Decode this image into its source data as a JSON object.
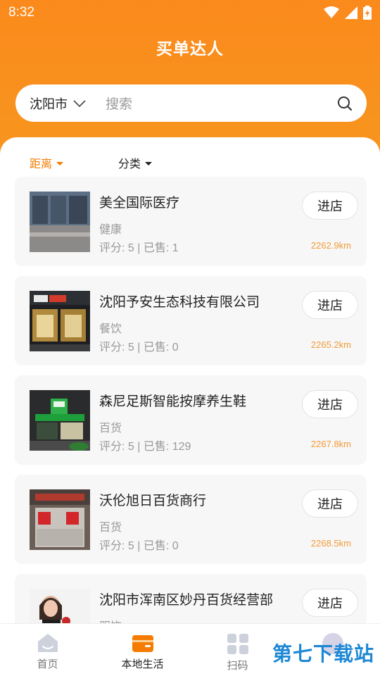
{
  "status": {
    "time": "8:32"
  },
  "header": {
    "title": "买单达人"
  },
  "search": {
    "city": "沈阳市",
    "placeholder": "搜索"
  },
  "filters": [
    {
      "label": "距离",
      "active": true
    },
    {
      "label": "分类",
      "active": false
    }
  ],
  "enter_label": "进店",
  "stores": [
    {
      "name": "美全国际医疗",
      "category": "健康",
      "meta": "评分: 5 | 已售: 1",
      "distance": "2262.9km"
    },
    {
      "name": "沈阳予安生态科技有限公司",
      "category": "餐饮",
      "meta": "评分: 5 | 已售: 0",
      "distance": "2265.2km"
    },
    {
      "name": "森尼足斯智能按摩养生鞋",
      "category": "百货",
      "meta": "评分: 5 | 已售: 129",
      "distance": "2267.8km"
    },
    {
      "name": "沃伦旭日百货商行",
      "category": "百货",
      "meta": "评分: 5 | 已售: 0",
      "distance": "2268.5km"
    },
    {
      "name": "沈阳市浑南区妙丹百货经营部",
      "category": "服饰",
      "meta": "",
      "distance": ""
    }
  ],
  "tabs": [
    {
      "label": "首页",
      "icon": "home-icon"
    },
    {
      "label": "本地生活",
      "icon": "wallet-icon"
    },
    {
      "label": "扫码",
      "icon": "grid-icon"
    },
    {
      "label": "",
      "icon": "avatar-icon"
    }
  ],
  "watermark": {
    "text": "第七下载站"
  },
  "colors": {
    "primary": "#fb8a1c",
    "distance": "#f39b37",
    "watermark": "#1e88d6"
  }
}
